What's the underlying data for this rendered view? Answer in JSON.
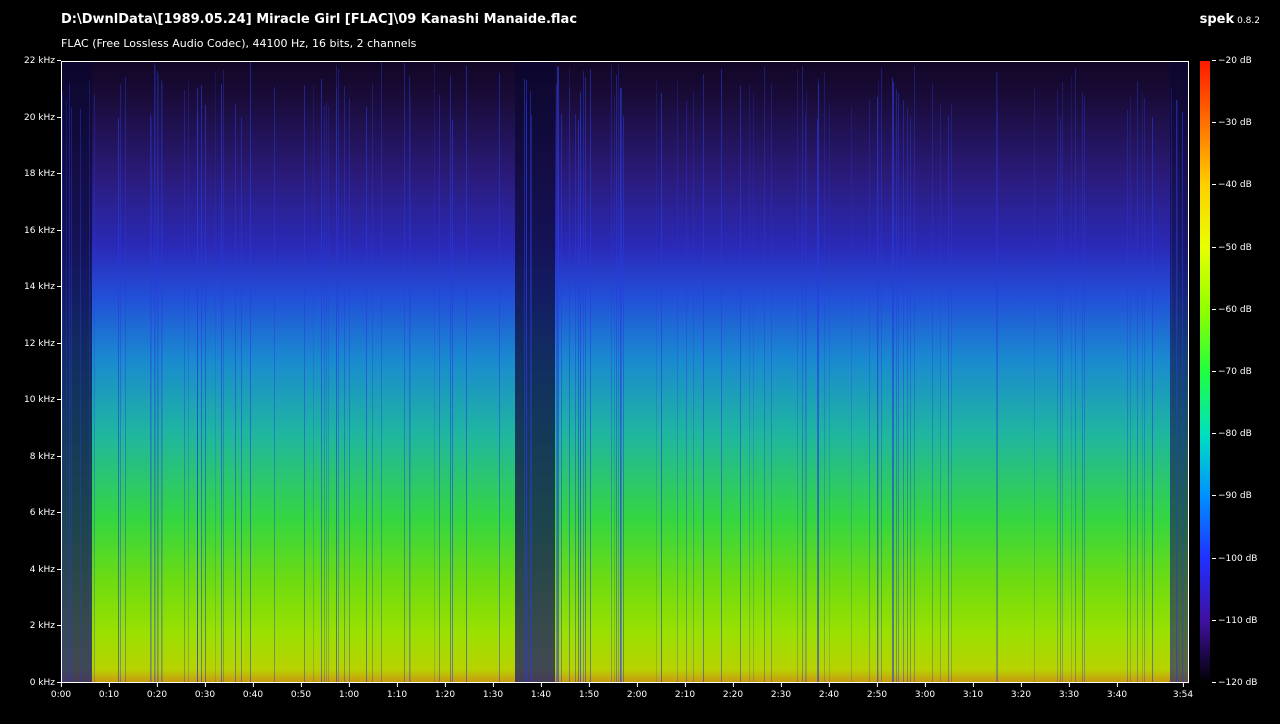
{
  "header": {
    "file_path": "D:\\DwnlData\\[1989.05.24] Miracle Girl [FLAC]\\09 Kanashi Manaide.flac",
    "file_info": "FLAC (Free Lossless Audio Codec), 44100 Hz, 16 bits, 2 channels",
    "app_name": "spek",
    "app_version": "0.8.2"
  },
  "y_axis": {
    "labels": [
      "22 kHz",
      "20 kHz",
      "18 kHz",
      "16 kHz",
      "14 kHz",
      "12 kHz",
      "10 kHz",
      "8 kHz",
      "6 kHz",
      "4 kHz",
      "2 kHz",
      "0 kHz"
    ]
  },
  "x_axis": {
    "labels": [
      "0:00",
      "0:10",
      "0:20",
      "0:30",
      "0:40",
      "0:50",
      "1:00",
      "1:10",
      "1:20",
      "1:30",
      "1:40",
      "1:50",
      "2:00",
      "2:10",
      "2:20",
      "2:30",
      "2:40",
      "2:50",
      "3:00",
      "3:10",
      "3:20",
      "3:30",
      "3:40",
      "3:54"
    ]
  },
  "colorbar": {
    "labels": [
      "−20 dB",
      "−30 dB",
      "−40 dB",
      "−50 dB",
      "−60 dB",
      "−70 dB",
      "−80 dB",
      "−90 dB",
      "−100 dB",
      "−110 dB",
      "−120 dB"
    ]
  }
}
